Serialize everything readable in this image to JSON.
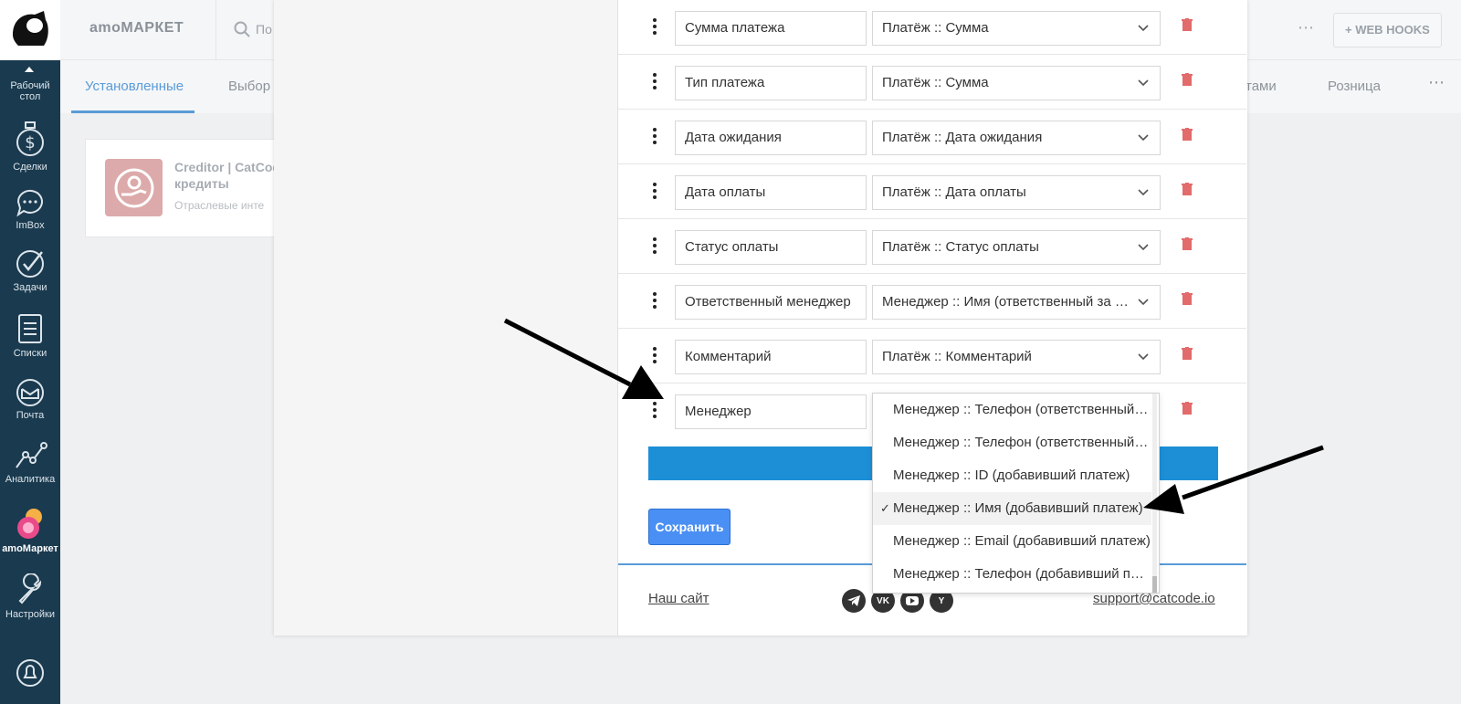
{
  "sidebar": {
    "items": [
      {
        "label": "Рабочий\nстол",
        "icon": "dashboard-icon"
      },
      {
        "label": "Сделки",
        "icon": "dollar-icon"
      },
      {
        "label": "ImBox",
        "icon": "chat-icon"
      },
      {
        "label": "Задачи",
        "icon": "check-icon"
      },
      {
        "label": "Списки",
        "icon": "list-icon"
      },
      {
        "label": "Почта",
        "icon": "mail-icon"
      },
      {
        "label": "Аналитика",
        "icon": "chart-icon"
      },
      {
        "label": "amoМаркет",
        "icon": "market-icon"
      },
      {
        "label": "Настройки",
        "icon": "settings-icon"
      }
    ]
  },
  "topbar": {
    "brand": "amoМАРКЕТ",
    "search_placeholder": "По",
    "webhooks_label": "+ WEB HOOKS"
  },
  "tabs": {
    "installed": "Установленные",
    "choice": "Выбор",
    "payments": "тами",
    "retail": "Розница"
  },
  "bg_card": {
    "title": "Creditor | CatCode кредиты",
    "subtitle": "Отраслевые инте"
  },
  "rows": [
    {
      "name": "Сумма платежа",
      "value": "Платёж :: Сумма"
    },
    {
      "name": "Тип платежа",
      "value": "Платёж :: Сумма"
    },
    {
      "name": "Дата ожидания",
      "value": "Платёж :: Дата ожидания"
    },
    {
      "name": "Дата оплаты",
      "value": "Платёж :: Дата оплаты"
    },
    {
      "name": "Статус оплаты",
      "value": "Платёж :: Статус оплаты"
    },
    {
      "name": "Ответственный менеджер",
      "value": "Менеджер :: Имя (ответственный за сделку)"
    },
    {
      "name": "Комментарий",
      "value": "Платёж :: Комментарий"
    },
    {
      "name": "Менеджер",
      "value": ""
    }
  ],
  "dropdown": {
    "options": [
      "Менеджер :: Телефон (ответственный за сделку)",
      "Менеджер :: Телефон (ответственный за сделку)",
      "Менеджер :: ID (добавивший платеж)",
      "Менеджер :: Имя (добавивший платеж)",
      "Менеджер :: Email (добавивший платеж)",
      "Менеджер :: Телефон (добавивший платеж)"
    ],
    "selected_index": 3,
    "check_mark": "✓"
  },
  "save_label": "Сохранить",
  "footer": {
    "site": "Наш сайт",
    "email": "support@catcode.io",
    "socials": [
      "telegram-icon",
      "vk-icon",
      "youtube-icon",
      "yandex-icon"
    ]
  },
  "colors": {
    "sidebar": "#1a3a4f",
    "accent": "#5a9bd8",
    "save": "#4a8ff3",
    "blue_bar": "#1d8fd7",
    "trash": "#e26b6b"
  }
}
